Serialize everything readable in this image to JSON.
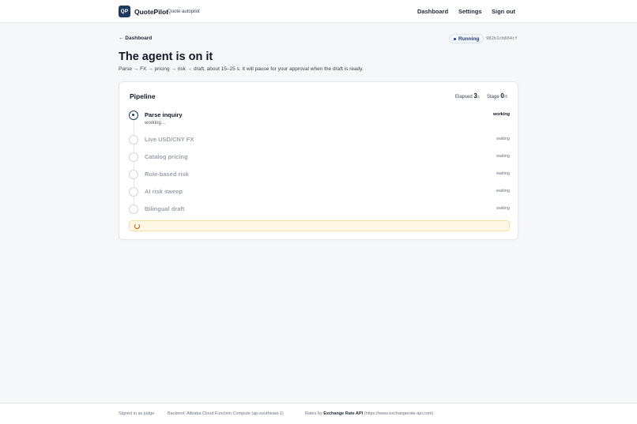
{
  "header": {
    "logo_text": "QP",
    "brand": "QuotePilot",
    "tagline": "Quote autopilot",
    "nav": {
      "dashboard": "Dashboard",
      "settings": "Settings",
      "sign_out": "Sign out"
    }
  },
  "back_link": "← Dashboard",
  "status": {
    "label": "Running",
    "run_id": "982b1cb664cf"
  },
  "title": "The agent is on it",
  "subtitle": "Parse → FX → pricing → risk → draft, about 15–25 s. It will pause for your approval when the draft is ready.",
  "pipeline": {
    "title": "Pipeline",
    "elapsed_label": "Elapsed",
    "elapsed_value": "3",
    "elapsed_unit": "s",
    "stage_label": "Stage",
    "stage_current": "0",
    "stage_total": "/6",
    "steps": [
      {
        "name": "Parse inquiry",
        "detail": "working…",
        "status": "working"
      },
      {
        "name": "Live USD/CNY FX",
        "status": "waiting"
      },
      {
        "name": "Catalog pricing",
        "status": "waiting"
      },
      {
        "name": "Rule-based risk",
        "status": "waiting"
      },
      {
        "name": "AI risk sweep",
        "status": "waiting"
      },
      {
        "name": "Bilingual draft",
        "status": "waiting"
      }
    ]
  },
  "footer": {
    "signed_in": "Signed in as judge",
    "backend": "Backend: Alibaba Cloud Function Compute (ap-southeast-1)",
    "rates_prefix": "Rates by",
    "rates_link": "Exchange Rate API",
    "rates_url": "(https://www.exchangerate-api.com)"
  },
  "colors": {
    "brand": "#1e3a5f",
    "accent": "#1e3a8a",
    "notice_bg": "#fef7e3"
  }
}
